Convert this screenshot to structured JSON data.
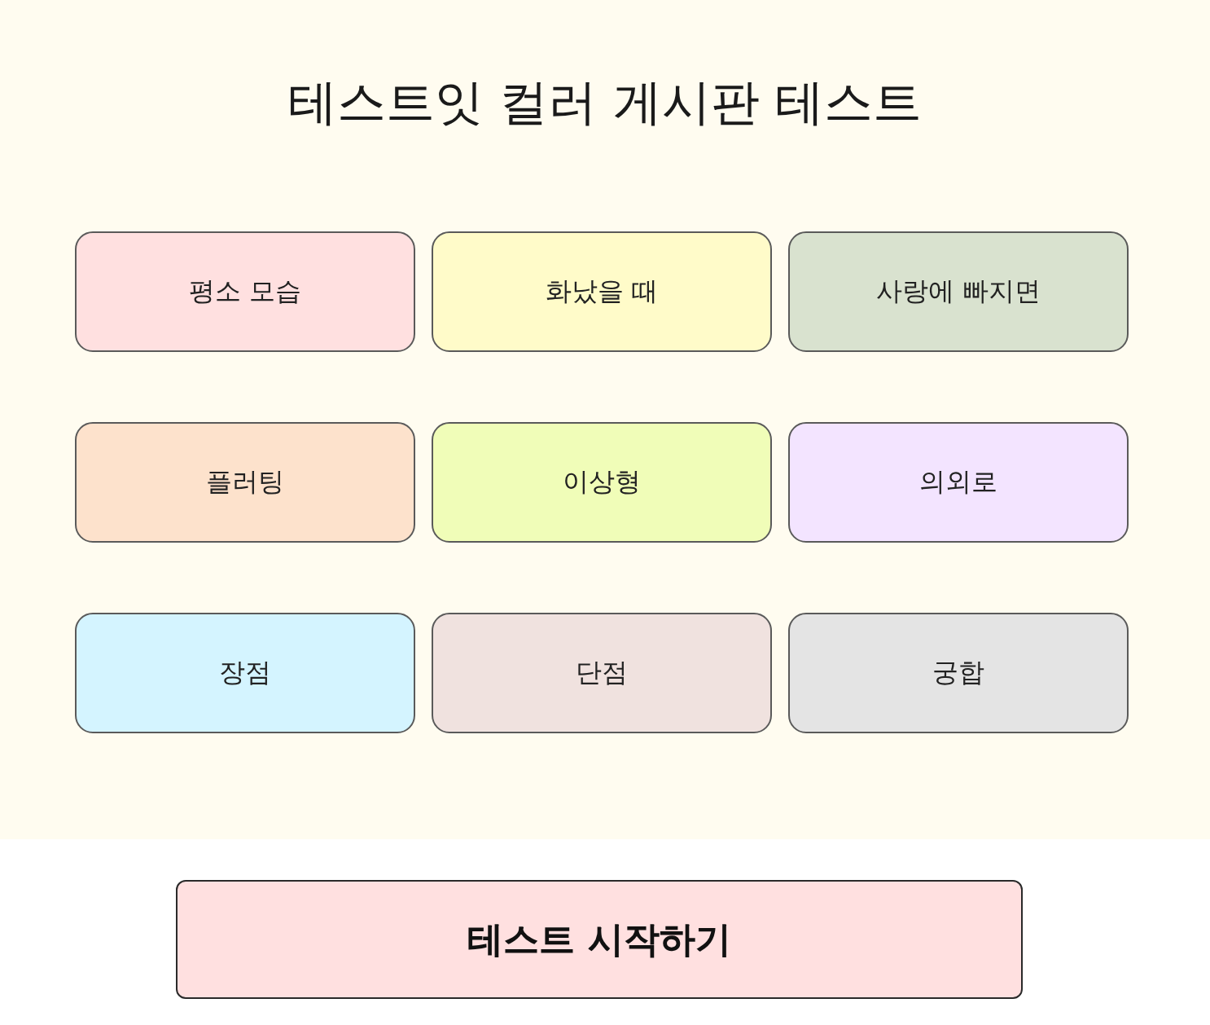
{
  "title": "테스트잇 컬러 게시판 테스트",
  "cards": [
    {
      "label": "평소 모습",
      "color": "#ffe0e0"
    },
    {
      "label": "화났을 때",
      "color": "#fffbc9"
    },
    {
      "label": "사랑에 빠지면",
      "color": "#d9e2cf"
    },
    {
      "label": "플러팅",
      "color": "#fde2cc"
    },
    {
      "label": "이상형",
      "color": "#f0fdb8"
    },
    {
      "label": "의외로",
      "color": "#f3e4ff"
    },
    {
      "label": "장점",
      "color": "#d4f4ff"
    },
    {
      "label": "단점",
      "color": "#f0e2df"
    },
    {
      "label": "궁합",
      "color": "#e4e4e4"
    }
  ],
  "start_button": {
    "label": "테스트 시작하기"
  }
}
